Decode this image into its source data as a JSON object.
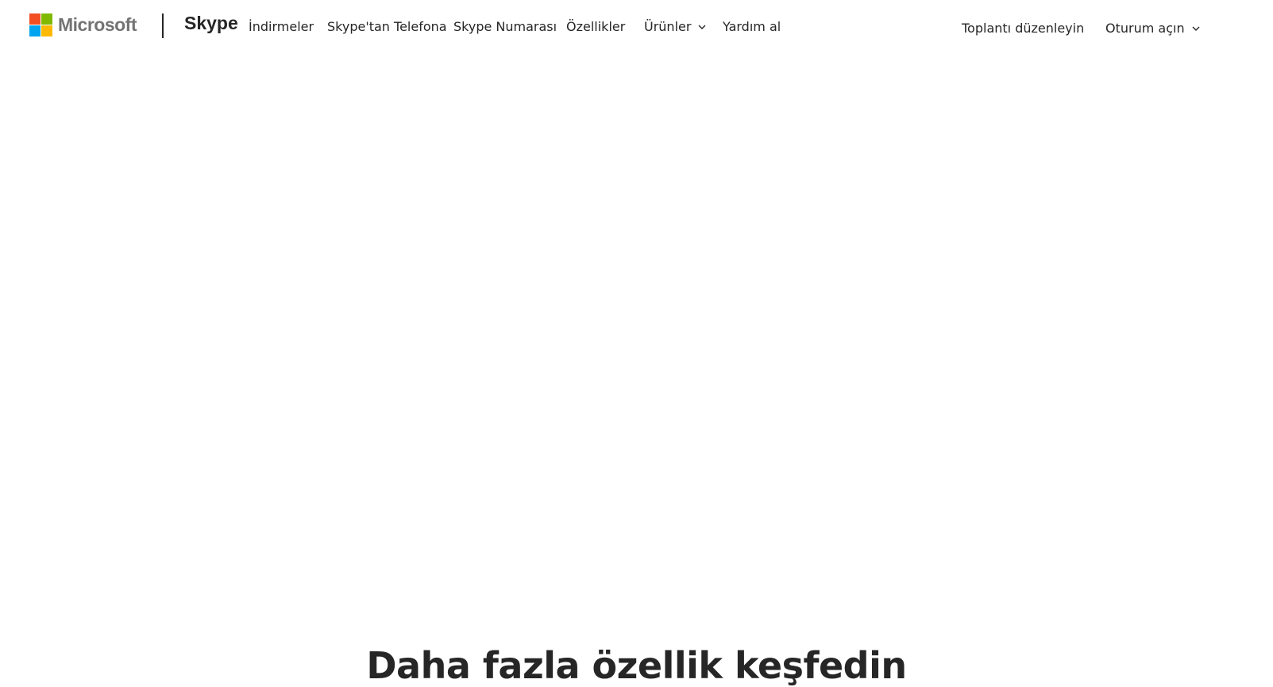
{
  "header": {
    "logo_text": "Microsoft",
    "logo_colors": [
      "#f25022",
      "#7fba00",
      "#00a4ef",
      "#ffb900"
    ],
    "brand": "Skype",
    "nav": [
      {
        "label": "İndirmeler"
      },
      {
        "label": "Skype'tan Telefona"
      },
      {
        "label": "Skype Numarası"
      },
      {
        "label": "Özellikler"
      },
      {
        "label": "Ürünler",
        "icon": "chevron-down-icon"
      },
      {
        "label": "Yardım al"
      }
    ],
    "right": {
      "meeting_link": "Toplantı düzenleyin",
      "signin_label": "Oturum açın",
      "signin_icon": "chevron-down-icon"
    }
  },
  "main": {
    "section_title": "Daha fazla özellik keşfedin"
  },
  "colors": {
    "text": "#262626",
    "background": "#ffffff"
  }
}
